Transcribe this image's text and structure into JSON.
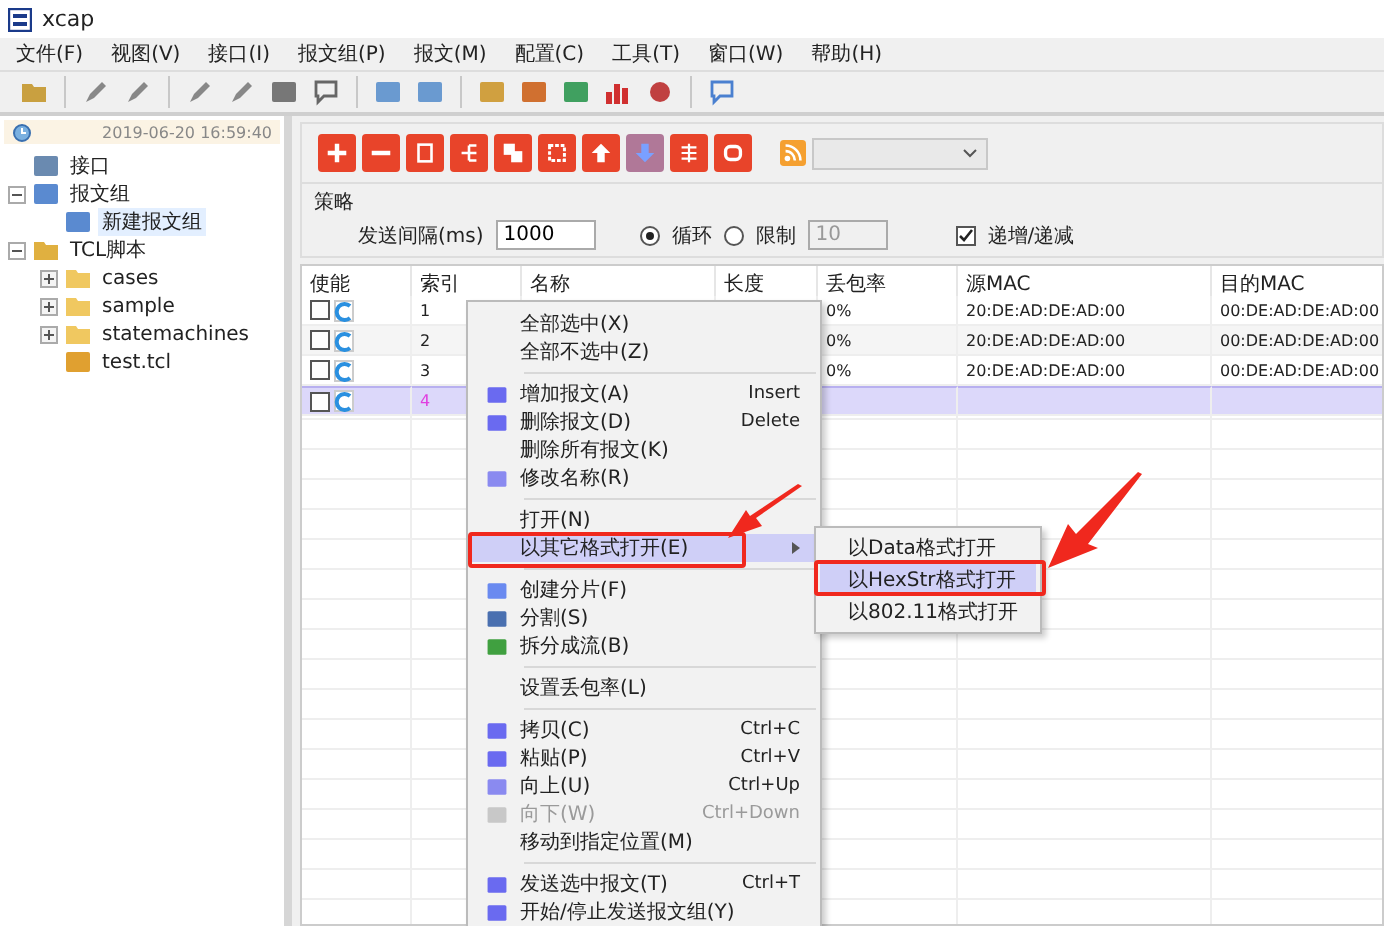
{
  "window": {
    "title": "xcap"
  },
  "menubar": [
    "文件(F)",
    "视图(V)",
    "接口(I)",
    "报文组(P)",
    "报文(M)",
    "配置(C)",
    "工具(T)",
    "窗口(W)",
    "帮助(H)"
  ],
  "sidebar": {
    "timestamp": "2019-06-20 16:59:40",
    "items": [
      {
        "label": "接口",
        "kind": "interface",
        "selected": false
      },
      {
        "label": "报文组",
        "kind": "group",
        "expanded": true,
        "selected": false,
        "children": [
          {
            "label": "新建报文组",
            "kind": "page",
            "selected": true
          }
        ]
      },
      {
        "label": "TCL脚本",
        "kind": "scripts",
        "expanded": true,
        "selected": false,
        "children": [
          {
            "label": "cases",
            "kind": "folder",
            "expanded": false,
            "selected": false
          },
          {
            "label": "sample",
            "kind": "folder",
            "expanded": false,
            "selected": false
          },
          {
            "label": "statemachines",
            "kind": "folder",
            "expanded": false,
            "selected": false
          },
          {
            "label": "test.tcl",
            "kind": "file",
            "selected": false
          }
        ]
      }
    ]
  },
  "strategy": {
    "legend": "策略",
    "interval_label": "发送间隔(ms)",
    "interval_value": "1000",
    "modes": [
      {
        "label": "循环",
        "selected": true
      },
      {
        "label": "限制",
        "selected": false
      }
    ],
    "limit_value": "10",
    "limit_disabled": true,
    "step": {
      "label": "递增/递减",
      "checked": true
    }
  },
  "table": {
    "columns": [
      "使能",
      "索引",
      "名称",
      "长度",
      "丢包率",
      "源MAC",
      "目的MAC"
    ],
    "rows": [
      {
        "enabled": false,
        "index": "1",
        "loss": "0%",
        "src_mac": "20:DE:AD:DE:AD:00",
        "dst_mac": "00:DE:AD:DE:AD:00",
        "selected": false
      },
      {
        "enabled": false,
        "index": "2",
        "loss": "0%",
        "src_mac": "20:DE:AD:DE:AD:00",
        "dst_mac": "00:DE:AD:DE:AD:00",
        "selected": false
      },
      {
        "enabled": false,
        "index": "3",
        "loss": "0%",
        "src_mac": "20:DE:AD:DE:AD:00",
        "dst_mac": "00:DE:AD:DE:AD:00",
        "selected": false
      },
      {
        "enabled": false,
        "index": "4",
        "selected": true
      }
    ]
  },
  "context_menu": [
    {
      "kind": "item",
      "label": "全部选中(X)",
      "disabled": false,
      "selected": false,
      "submenu": false
    },
    {
      "kind": "item",
      "label": "全部不选中(Z)",
      "disabled": false,
      "selected": false,
      "submenu": false
    },
    {
      "kind": "separator"
    },
    {
      "kind": "item",
      "label": "增加报文(A)",
      "shortcut": "Insert",
      "disabled": false,
      "selected": false,
      "submenu": false
    },
    {
      "kind": "item",
      "label": "删除报文(D)",
      "shortcut": "Delete",
      "disabled": false,
      "selected": false,
      "submenu": false
    },
    {
      "kind": "item",
      "label": "删除所有报文(K)",
      "disabled": false,
      "selected": false,
      "submenu": false
    },
    {
      "kind": "item",
      "label": "修改名称(R)",
      "disabled": false,
      "selected": false,
      "submenu": false
    },
    {
      "kind": "separator"
    },
    {
      "kind": "item",
      "label": "打开(N)",
      "disabled": false,
      "selected": false,
      "submenu": false
    },
    {
      "kind": "item",
      "label": "以其它格式打开(E)",
      "disabled": false,
      "selected": true,
      "submenu": true
    },
    {
      "kind": "separator"
    },
    {
      "kind": "item",
      "label": "创建分片(F)",
      "disabled": false,
      "selected": false,
      "submenu": false
    },
    {
      "kind": "item",
      "label": "分割(S)",
      "disabled": false,
      "selected": false,
      "submenu": false
    },
    {
      "kind": "item",
      "label": "拆分成流(B)",
      "disabled": false,
      "selected": false,
      "submenu": false
    },
    {
      "kind": "separator"
    },
    {
      "kind": "item",
      "label": "设置丢包率(L)",
      "disabled": false,
      "selected": false,
      "submenu": false
    },
    {
      "kind": "separator"
    },
    {
      "kind": "item",
      "label": "拷贝(C)",
      "shortcut": "Ctrl+C",
      "disabled": false,
      "selected": false,
      "submenu": false
    },
    {
      "kind": "item",
      "label": "粘贴(P)",
      "shortcut": "Ctrl+V",
      "disabled": false,
      "selected": false,
      "submenu": false
    },
    {
      "kind": "item",
      "label": "向上(U)",
      "shortcut": "Ctrl+Up",
      "disabled": false,
      "selected": false,
      "submenu": false
    },
    {
      "kind": "item",
      "label": "向下(W)",
      "shortcut": "Ctrl+Down",
      "disabled": true,
      "selected": false,
      "submenu": false
    },
    {
      "kind": "item",
      "label": "移动到指定位置(M)",
      "disabled": false,
      "selected": false,
      "submenu": false
    },
    {
      "kind": "separator"
    },
    {
      "kind": "item",
      "label": "发送选中报文(T)",
      "shortcut": "Ctrl+T",
      "disabled": false,
      "selected": false,
      "submenu": false
    },
    {
      "kind": "item",
      "label": "开始/停止发送报文组(Y)",
      "disabled": false,
      "selected": false,
      "submenu": false
    }
  ],
  "submenu": [
    {
      "label": "以Data格式打开",
      "selected": false
    },
    {
      "label": "以HexStr格式打开",
      "selected": true
    },
    {
      "label": "以802.11格式打开",
      "selected": false
    }
  ]
}
